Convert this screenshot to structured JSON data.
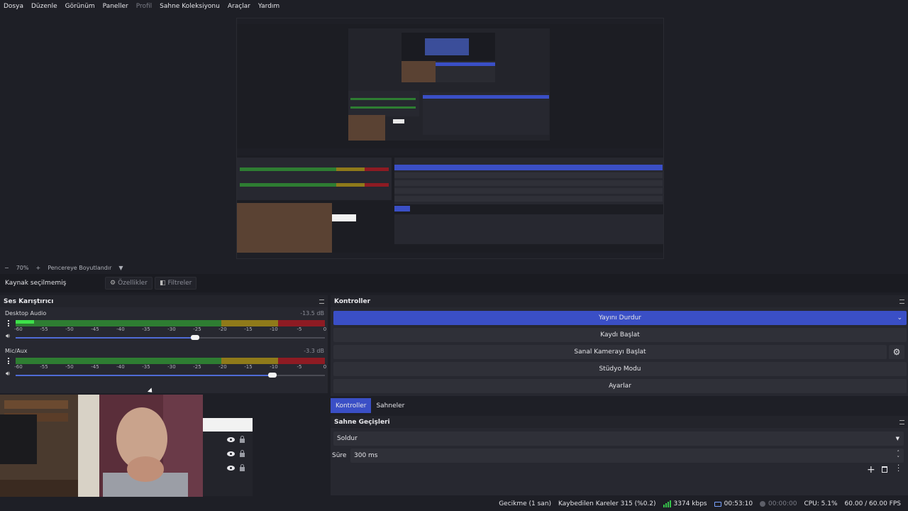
{
  "menu": [
    "Dosya",
    "Düzenle",
    "Görünüm",
    "Paneller",
    "Profil",
    "Sahne Koleksiyonu",
    "Araçlar",
    "Yardım"
  ],
  "zoombar": {
    "minus": "−",
    "zoom": "70%",
    "plus": "+",
    "fit": "Pencereye Boyutlandır",
    "dropdown_icon": "chevron-down-icon"
  },
  "context": {
    "no_source": "Kaynak seçilmemiş",
    "properties": "Özellikler",
    "filters": "Filtreler"
  },
  "mixer": {
    "title": "Ses Karıştırıcı",
    "ticks": [
      "-60",
      "-55",
      "-50",
      "-45",
      "-40",
      "-35",
      "-30",
      "-25",
      "-20",
      "-15",
      "-10",
      "-5",
      "0"
    ],
    "channels": [
      {
        "name": "Desktop Audio",
        "db": "-13.5 dB",
        "level": 0.06,
        "volume": 0.58
      },
      {
        "name": "Mic/Aux",
        "db": "-3.3 dB",
        "level": 0.0,
        "volume": 0.83
      }
    ]
  },
  "controls": {
    "title": "Kontroller",
    "stop_stream": "Yayını Durdur",
    "start_record": "Kaydı Başlat",
    "virtual_cam": "Sanal Kamerayı Başlat",
    "studio_mode": "Stüdyo Modu",
    "settings": "Ayarlar"
  },
  "tabs": [
    {
      "label": "Kontroller",
      "active": true
    },
    {
      "label": "Sahneler",
      "active": false
    }
  ],
  "transitions": {
    "title": "Sahne Geçişleri",
    "type": "Soldur",
    "duration_label": "Süre",
    "duration_value": "300 ms"
  },
  "status": {
    "delay": "Gecikme (1 san)",
    "dropped": "Kaybedilen Kareler 315 (%0.2)",
    "bitrate": "3374 kbps",
    "stream_time": "00:53:10",
    "record_time": "00:00:00",
    "cpu": "CPU: 5.1%",
    "fps": "60.00 / 60.00 FPS"
  },
  "colors": {
    "accent": "#3a4fc6",
    "meter_green": "#2e7d32",
    "meter_yellow": "#8f7a1a",
    "meter_red": "#8e1b23",
    "bg": "#1e1f26"
  }
}
